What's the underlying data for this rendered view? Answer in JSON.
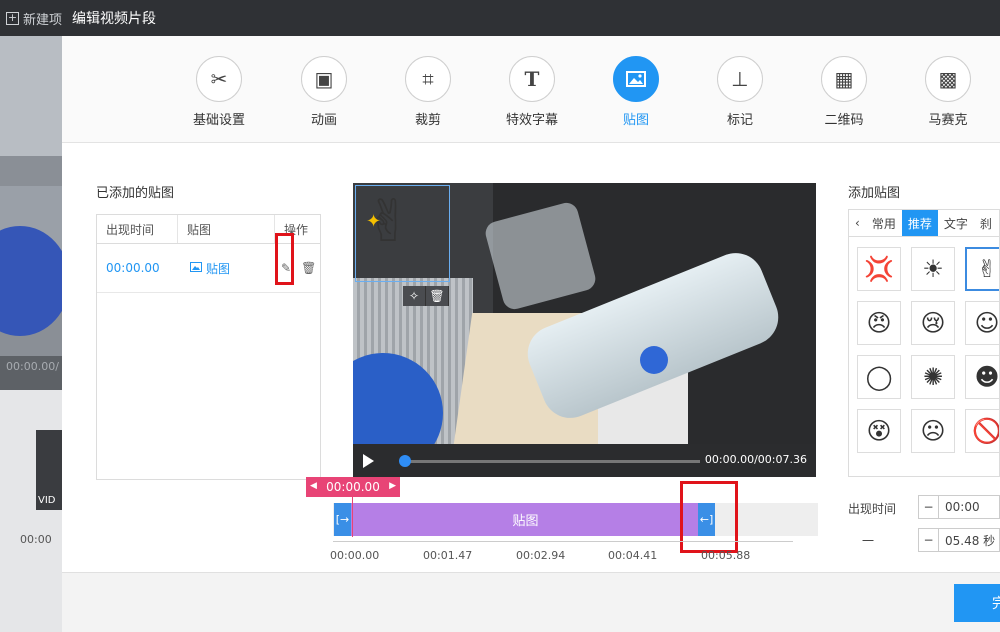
{
  "background": {
    "new_project": "新建项",
    "time1": "00:00.00/",
    "thumb_label": "VID",
    "time2": "00:00"
  },
  "dialog": {
    "title": "编辑视频片段"
  },
  "toolbar": {
    "items": [
      {
        "label": "基础设置",
        "icon": "scissors-icon"
      },
      {
        "label": "动画",
        "icon": "animation-icon"
      },
      {
        "label": "裁剪",
        "icon": "crop-icon"
      },
      {
        "label": "特效字幕",
        "icon": "text-icon"
      },
      {
        "label": "贴图",
        "icon": "image-icon"
      },
      {
        "label": "标记",
        "icon": "pin-icon"
      },
      {
        "label": "二维码",
        "icon": "qrcode-icon"
      },
      {
        "label": "马赛克",
        "icon": "mosaic-icon"
      }
    ],
    "active": "贴图",
    "accent_color": "#2196f3"
  },
  "left_panel": {
    "title": "已添加的贴图",
    "columns": [
      "出现时间",
      "贴图",
      "操作"
    ],
    "rows": [
      {
        "time": "00:00.00",
        "sticker": "贴图"
      }
    ]
  },
  "player": {
    "time": "00:00.00/00:07.36",
    "progress": 0
  },
  "timeline": {
    "playhead": "00:00.00",
    "clip_label": "贴图",
    "ticks": [
      "00:00.00",
      "00:01.47",
      "00:02.94",
      "00:04.41",
      "00:05.88"
    ],
    "clip_color": "#b57fe6",
    "playhead_color": "#e84476"
  },
  "right_panel": {
    "title": "添加贴图",
    "tabs": [
      "常用",
      "推荐",
      "文字",
      "刹"
    ],
    "selected_tab": "推荐",
    "appear_label": "出现时间",
    "appear_value": "00:00",
    "duration_value": "05.48 秒",
    "duration_label": "一"
  },
  "footer": {
    "ok_label": "完"
  }
}
